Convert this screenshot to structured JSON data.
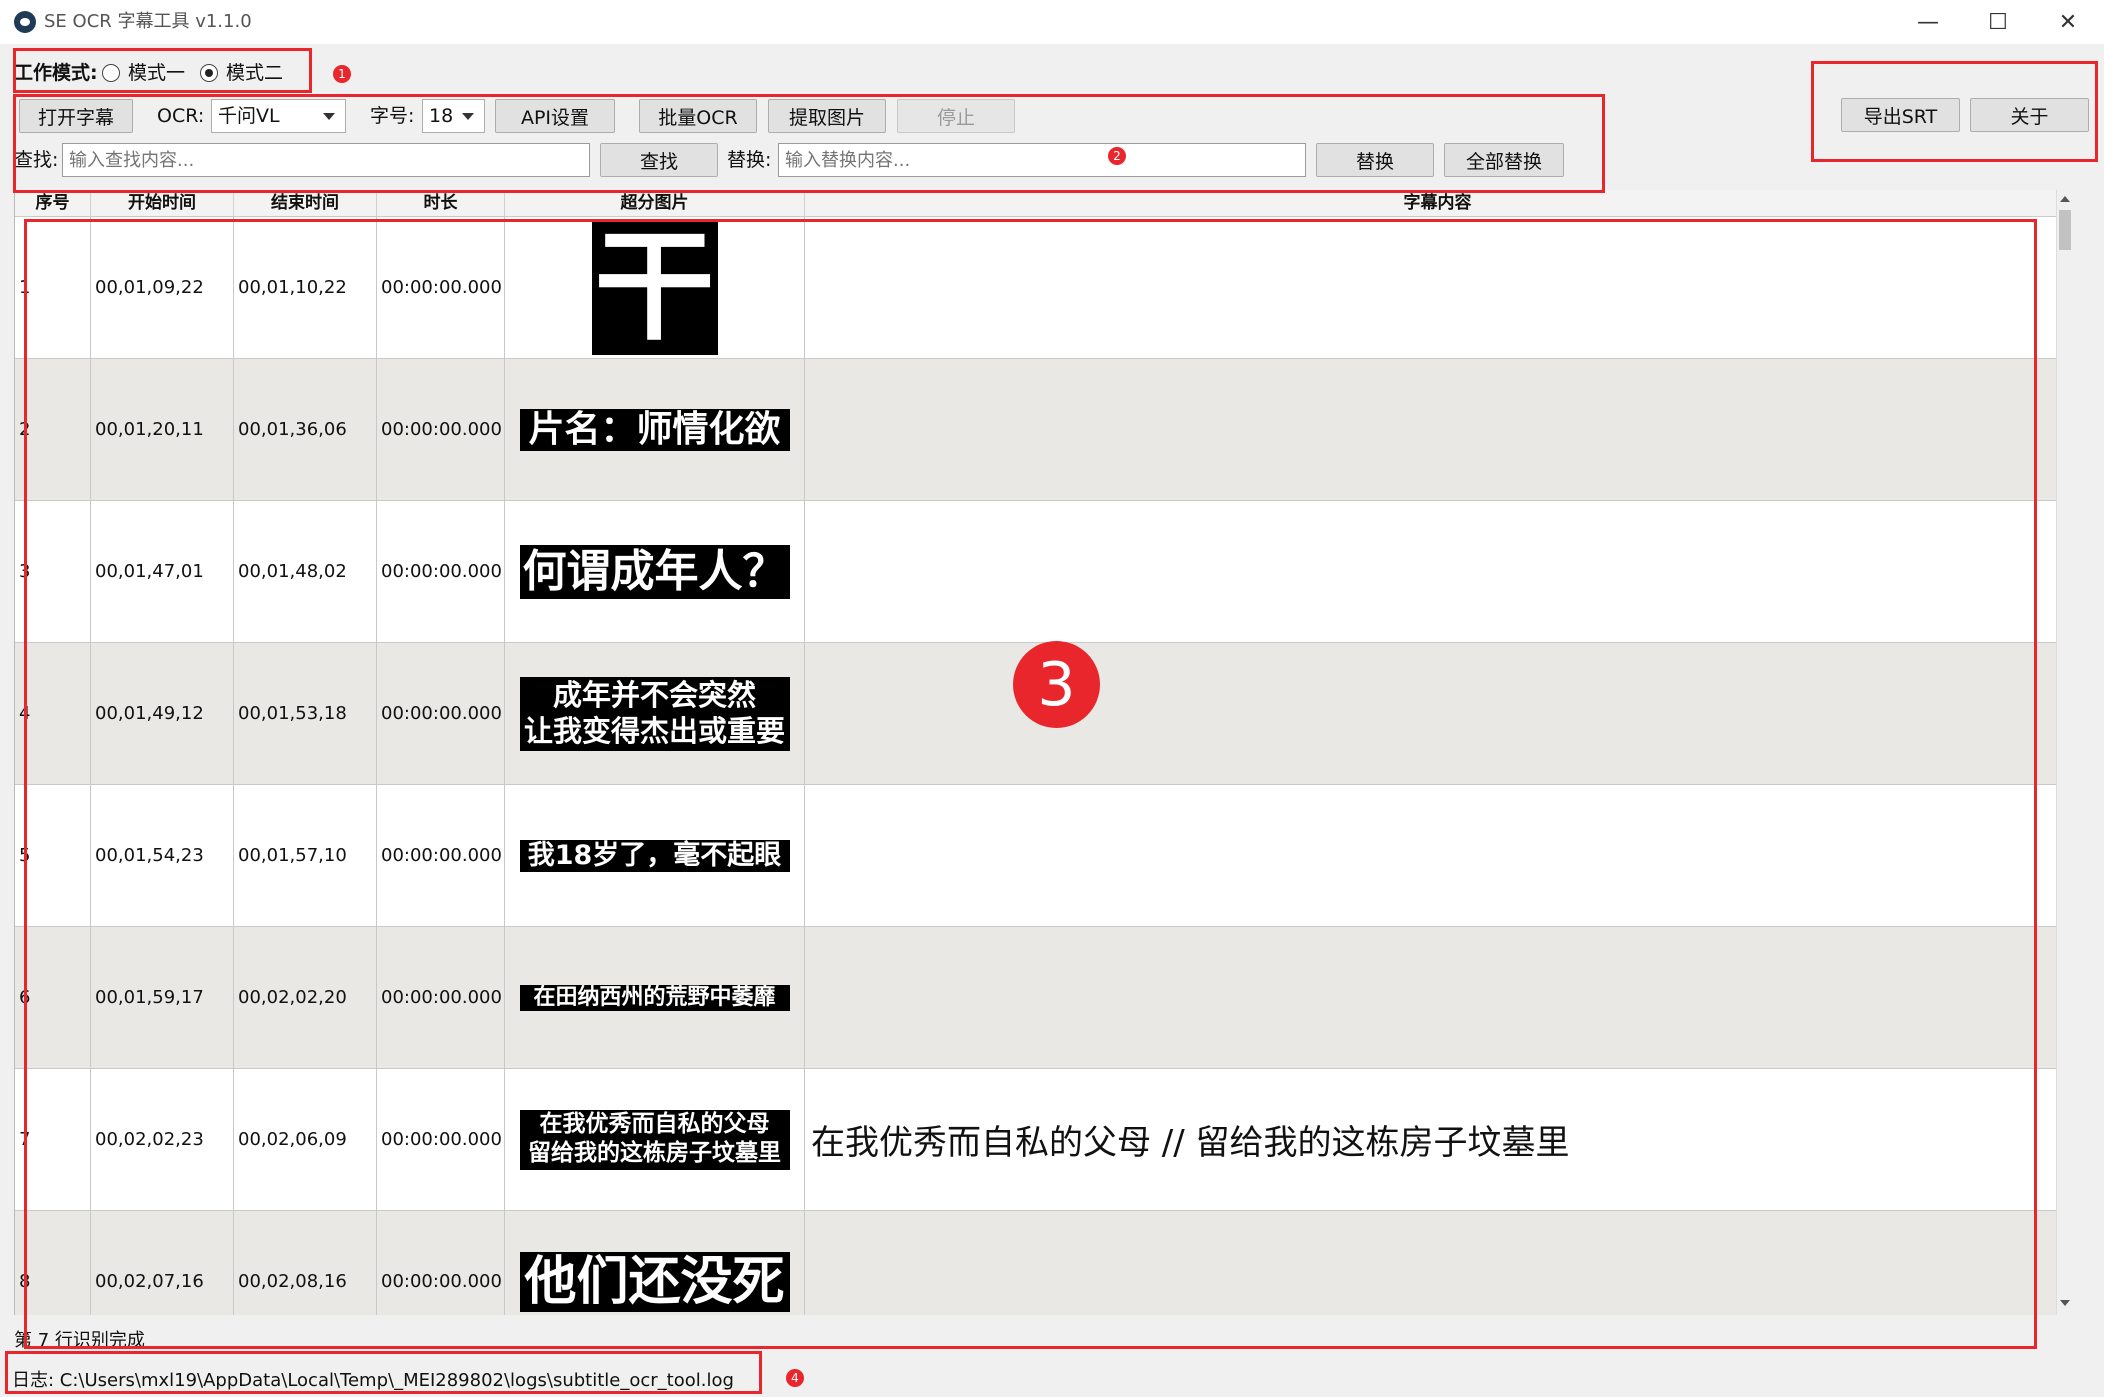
{
  "window": {
    "title": "SE OCR 字幕工具 v1.1.0",
    "minimize": "—",
    "maximize": "☐",
    "close": "✕"
  },
  "mode": {
    "label": "工作模式:",
    "option1": "模式一",
    "option2": "模式二",
    "selected": "模式二"
  },
  "toolbar": {
    "open_subtitle": "打开字幕",
    "ocr_label": "OCR:",
    "ocr_value": "千问VL",
    "font_size_label": "字号:",
    "font_size_value": "18",
    "api_settings": "API设置",
    "batch_ocr": "批量OCR",
    "extract_images": "提取图片",
    "stop": "停止",
    "export_srt": "导出SRT",
    "about": "关于"
  },
  "search": {
    "find_label": "查找:",
    "find_placeholder": "输入查找内容...",
    "find_button": "查找",
    "replace_label": "替换:",
    "replace_placeholder": "输入替换内容...",
    "replace_button": "替换",
    "replace_all_button": "全部替换"
  },
  "table": {
    "headers": [
      "序号",
      "开始时间",
      "结束时间",
      "时长",
      "超分图片",
      "字幕内容"
    ],
    "rows": [
      {
        "index": "1",
        "start": "00,01,09,22",
        "end": "00,01,10,22",
        "duration": "00:00:00.000",
        "image_text": "干",
        "content": ""
      },
      {
        "index": "2",
        "start": "00,01,20,11",
        "end": "00,01,36,06",
        "duration": "00:00:00.000",
        "image_text": "片名：师情化欲",
        "content": ""
      },
      {
        "index": "3",
        "start": "00,01,47,01",
        "end": "00,01,48,02",
        "duration": "00:00:00.000",
        "image_text": "何谓成年人？",
        "content": ""
      },
      {
        "index": "4",
        "start": "00,01,49,12",
        "end": "00,01,53,18",
        "duration": "00:00:00.000",
        "image_text": "成年并不会突然\n让我变得杰出或重要",
        "content": ""
      },
      {
        "index": "5",
        "start": "00,01,54,23",
        "end": "00,01,57,10",
        "duration": "00:00:00.000",
        "image_text": "我18岁了，毫不起眼",
        "content": ""
      },
      {
        "index": "6",
        "start": "00,01,59,17",
        "end": "00,02,02,20",
        "duration": "00:00:00.000",
        "image_text": "在田纳西州的荒野中萎靡",
        "content": ""
      },
      {
        "index": "7",
        "start": "00,02,02,23",
        "end": "00,02,06,09",
        "duration": "00:00:00.000",
        "image_text": "在我优秀而自私的父母\n留给我的这栋房子坟墓里",
        "content": "在我优秀而自私的父母 // 留给我的这栋房子坟墓里"
      },
      {
        "index": "8",
        "start": "00,02,07,16",
        "end": "00,02,08,16",
        "duration": "00:00:00.000",
        "image_text": "他们还没死",
        "content": ""
      }
    ]
  },
  "status": {
    "progress": "第 7 行识别完成",
    "log": "日志: C:\\Users\\mxl19\\AppData\\Local\\Temp\\_MEI289802\\logs\\subtitle_ocr_tool.log"
  },
  "annotations": {
    "n1": "1",
    "n2": "2",
    "n3": "3",
    "n4": "4",
    "color": "#e8262b"
  }
}
